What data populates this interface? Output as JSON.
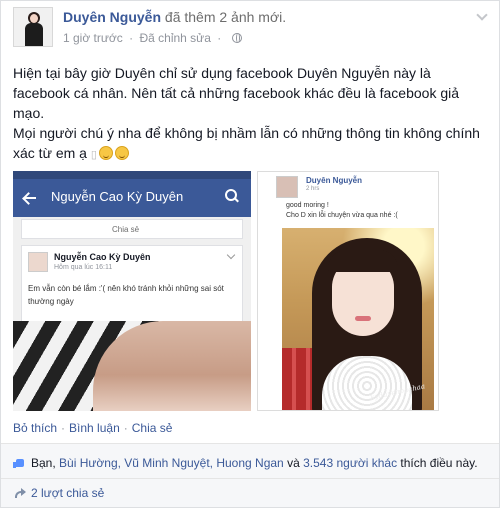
{
  "post": {
    "author": "Duyên Nguyễn",
    "action": "đã thêm 2 ảnh mới.",
    "time": "1 giờ trước",
    "edited": "Đã chỉnh sửa",
    "dot": "·",
    "body_line1": "Hiện tại bây giờ Duyên chỉ sử dụng facebook Duyên Nguyễn này là facebook cá nhân. Nên tất cả những facebook khác đều là facebook giả mạo.",
    "body_line2": "Mọi người chú ý nha để không bị nhầm lẫn có những thông tin không chính xác từ em ạ",
    "body_glyph": "▯"
  },
  "photo_left": {
    "bar_title": "Nguyễn Cao Kỳ Duyên",
    "share_label": "Chia sẻ",
    "inner_name": "Nguyễn Cao Kỳ Duyên",
    "inner_time": "Hôm qua lúc 16:11",
    "inner_text": "Em vẫn còn bé lắm :'( nên khó tránh khỏi những sai sót thường ngày"
  },
  "photo_right": {
    "name": "Duyên Nguyễn",
    "time": "2 hrs",
    "line1": "good moring !",
    "line2": "Cho D xin lỗi chuyện vừa qua nhé :(",
    "watermark": "kyduyenbaahaa"
  },
  "actions": {
    "like": "Bỏ thích",
    "comment": "Bình luận",
    "share": "Chia sẻ",
    "sep": "·"
  },
  "likes": {
    "prefix": "Bạn,",
    "names": "Bùi Hường, Vũ Minh Nguyệt, Huong Ngan",
    "and": "và",
    "others": "3.543 người khác",
    "suffix": "thích điều này."
  },
  "shares": {
    "label": "2 lượt chia sẻ"
  },
  "colors": {
    "link": "#3b5998",
    "meta": "#90949c",
    "fb_bar": "#3b5998"
  }
}
